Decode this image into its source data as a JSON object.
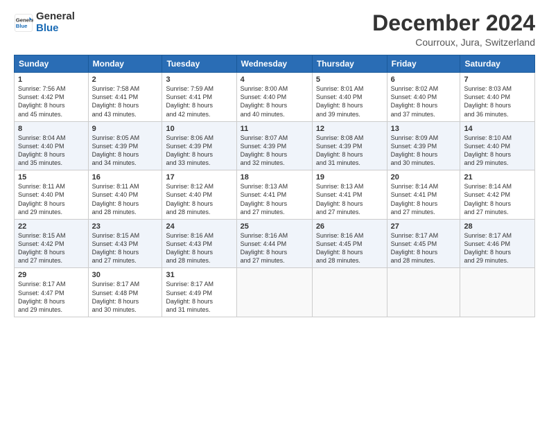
{
  "header": {
    "logo_general": "General",
    "logo_blue": "Blue",
    "month": "December 2024",
    "location": "Courroux, Jura, Switzerland"
  },
  "days_of_week": [
    "Sunday",
    "Monday",
    "Tuesday",
    "Wednesday",
    "Thursday",
    "Friday",
    "Saturday"
  ],
  "weeks": [
    [
      {
        "day": 1,
        "sunrise": "7:56 AM",
        "sunset": "4:42 PM",
        "daylight": "8 hours and 45 minutes."
      },
      {
        "day": 2,
        "sunrise": "7:58 AM",
        "sunset": "4:41 PM",
        "daylight": "8 hours and 43 minutes."
      },
      {
        "day": 3,
        "sunrise": "7:59 AM",
        "sunset": "4:41 PM",
        "daylight": "8 hours and 42 minutes."
      },
      {
        "day": 4,
        "sunrise": "8:00 AM",
        "sunset": "4:40 PM",
        "daylight": "8 hours and 40 minutes."
      },
      {
        "day": 5,
        "sunrise": "8:01 AM",
        "sunset": "4:40 PM",
        "daylight": "8 hours and 39 minutes."
      },
      {
        "day": 6,
        "sunrise": "8:02 AM",
        "sunset": "4:40 PM",
        "daylight": "8 hours and 37 minutes."
      },
      {
        "day": 7,
        "sunrise": "8:03 AM",
        "sunset": "4:40 PM",
        "daylight": "8 hours and 36 minutes."
      }
    ],
    [
      {
        "day": 8,
        "sunrise": "8:04 AM",
        "sunset": "4:40 PM",
        "daylight": "8 hours and 35 minutes."
      },
      {
        "day": 9,
        "sunrise": "8:05 AM",
        "sunset": "4:39 PM",
        "daylight": "8 hours and 34 minutes."
      },
      {
        "day": 10,
        "sunrise": "8:06 AM",
        "sunset": "4:39 PM",
        "daylight": "8 hours and 33 minutes."
      },
      {
        "day": 11,
        "sunrise": "8:07 AM",
        "sunset": "4:39 PM",
        "daylight": "8 hours and 32 minutes."
      },
      {
        "day": 12,
        "sunrise": "8:08 AM",
        "sunset": "4:39 PM",
        "daylight": "8 hours and 31 minutes."
      },
      {
        "day": 13,
        "sunrise": "8:09 AM",
        "sunset": "4:39 PM",
        "daylight": "8 hours and 30 minutes."
      },
      {
        "day": 14,
        "sunrise": "8:10 AM",
        "sunset": "4:40 PM",
        "daylight": "8 hours and 29 minutes."
      }
    ],
    [
      {
        "day": 15,
        "sunrise": "8:11 AM",
        "sunset": "4:40 PM",
        "daylight": "8 hours and 29 minutes."
      },
      {
        "day": 16,
        "sunrise": "8:11 AM",
        "sunset": "4:40 PM",
        "daylight": "8 hours and 28 minutes."
      },
      {
        "day": 17,
        "sunrise": "8:12 AM",
        "sunset": "4:40 PM",
        "daylight": "8 hours and 28 minutes."
      },
      {
        "day": 18,
        "sunrise": "8:13 AM",
        "sunset": "4:41 PM",
        "daylight": "8 hours and 27 minutes."
      },
      {
        "day": 19,
        "sunrise": "8:13 AM",
        "sunset": "4:41 PM",
        "daylight": "8 hours and 27 minutes."
      },
      {
        "day": 20,
        "sunrise": "8:14 AM",
        "sunset": "4:41 PM",
        "daylight": "8 hours and 27 minutes."
      },
      {
        "day": 21,
        "sunrise": "8:14 AM",
        "sunset": "4:42 PM",
        "daylight": "8 hours and 27 minutes."
      }
    ],
    [
      {
        "day": 22,
        "sunrise": "8:15 AM",
        "sunset": "4:42 PM",
        "daylight": "8 hours and 27 minutes."
      },
      {
        "day": 23,
        "sunrise": "8:15 AM",
        "sunset": "4:43 PM",
        "daylight": "8 hours and 27 minutes."
      },
      {
        "day": 24,
        "sunrise": "8:16 AM",
        "sunset": "4:43 PM",
        "daylight": "8 hours and 28 minutes."
      },
      {
        "day": 25,
        "sunrise": "8:16 AM",
        "sunset": "4:44 PM",
        "daylight": "8 hours and 27 minutes."
      },
      {
        "day": 26,
        "sunrise": "8:16 AM",
        "sunset": "4:45 PM",
        "daylight": "8 hours and 28 minutes."
      },
      {
        "day": 27,
        "sunrise": "8:17 AM",
        "sunset": "4:45 PM",
        "daylight": "8 hours and 28 minutes."
      },
      {
        "day": 28,
        "sunrise": "8:17 AM",
        "sunset": "4:46 PM",
        "daylight": "8 hours and 29 minutes."
      }
    ],
    [
      {
        "day": 29,
        "sunrise": "8:17 AM",
        "sunset": "4:47 PM",
        "daylight": "8 hours and 29 minutes."
      },
      {
        "day": 30,
        "sunrise": "8:17 AM",
        "sunset": "4:48 PM",
        "daylight": "8 hours and 30 minutes."
      },
      {
        "day": 31,
        "sunrise": "8:17 AM",
        "sunset": "4:49 PM",
        "daylight": "8 hours and 31 minutes."
      },
      null,
      null,
      null,
      null
    ]
  ]
}
